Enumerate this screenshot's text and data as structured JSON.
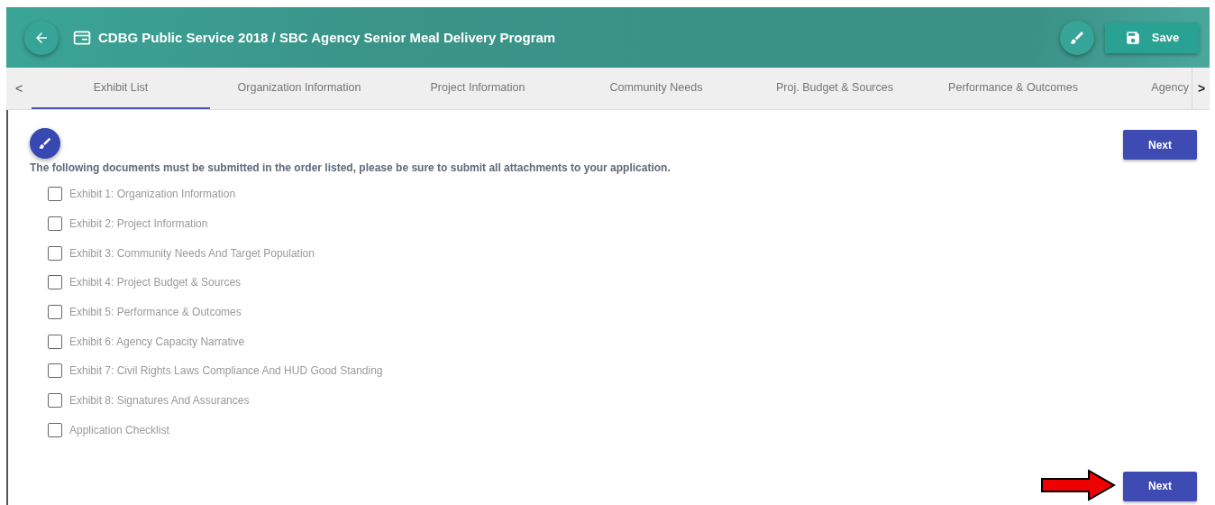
{
  "header": {
    "title": "CDBG Public Service 2018 / SBC Agency Senior Meal Delivery Program",
    "save_label": "Save"
  },
  "tabs": [
    {
      "label": "Exhibit List",
      "selected": true
    },
    {
      "label": "Organization Information",
      "selected": false
    },
    {
      "label": "Project Information",
      "selected": false
    },
    {
      "label": "Community Needs",
      "selected": false
    },
    {
      "label": "Proj. Budget & Sources",
      "selected": false
    },
    {
      "label": "Performance & Outcomes",
      "selected": false
    },
    {
      "label": "Agency",
      "selected": false
    }
  ],
  "tab_prev": "<",
  "tab_next": ">",
  "next_top": "Next",
  "instructions": "The following documents must be submitted in the order listed, please be sure to submit all attachments to your application.",
  "exhibits": [
    {
      "label": "Exhibit 1: Organization Information",
      "checked": false
    },
    {
      "label": "Exhibit 2: Project Information",
      "checked": false
    },
    {
      "label": "Exhibit 3: Community Needs And Target Population",
      "checked": false
    },
    {
      "label": "Exhibit 4: Project Budget & Sources",
      "checked": false
    },
    {
      "label": "Exhibit 5: Performance & Outcomes",
      "checked": false
    },
    {
      "label": "Exhibit 6: Agency Capacity Narrative",
      "checked": false
    },
    {
      "label": "Exhibit 7: Civil Rights Laws Compliance And HUD Good Standing",
      "checked": false
    },
    {
      "label": "Exhibit 8: Signatures And Assurances",
      "checked": false
    },
    {
      "label": "Application Checklist",
      "checked": false
    }
  ],
  "next_bottom": "Next"
}
